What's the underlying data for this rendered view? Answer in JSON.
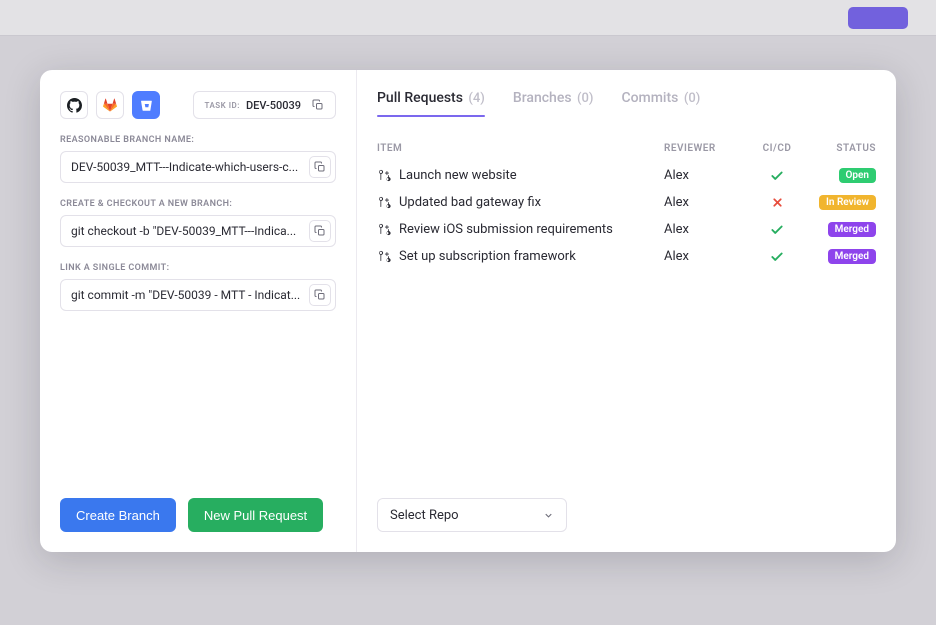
{
  "task_id": {
    "label": "TASK ID:",
    "value": "DEV-50039"
  },
  "fields": {
    "branch_name": {
      "label": "REASONABLE BRANCH NAME:",
      "value": "DEV-50039_MTT---Indicate-which-users-c..."
    },
    "checkout": {
      "label": "CREATE & CHECKOUT A NEW BRANCH:",
      "value": "git checkout -b \"DEV-50039_MTT---Indica..."
    },
    "commit": {
      "label": "LINK A SINGLE COMMIT:",
      "value": "git commit -m \"DEV-50039 - MTT - Indicat..."
    }
  },
  "buttons": {
    "create_branch": "Create Branch",
    "new_pr": "New Pull Request"
  },
  "tabs": [
    {
      "label": "Pull Requests",
      "count": "(4)"
    },
    {
      "label": "Branches",
      "count": "(0)"
    },
    {
      "label": "Commits",
      "count": "(0)"
    }
  ],
  "columns": {
    "item": "ITEM",
    "reviewer": "REVIEWER",
    "ci": "CI/CD",
    "status": "STATUS"
  },
  "rows": [
    {
      "title": "Launch new website",
      "reviewer": "Alex",
      "ci": "check",
      "status": "Open"
    },
    {
      "title": "Updated bad gateway fix",
      "reviewer": "Alex",
      "ci": "cross",
      "status": "In Review"
    },
    {
      "title": "Review iOS submission requirements",
      "reviewer": "Alex",
      "ci": "check",
      "status": "Merged"
    },
    {
      "title": "Set up subscription framework",
      "reviewer": "Alex",
      "ci": "check",
      "status": "Merged"
    }
  ],
  "select_repo": "Select Repo",
  "status_colors": {
    "Open": "badge-open",
    "In Review": "badge-review",
    "Merged": "badge-merged"
  }
}
